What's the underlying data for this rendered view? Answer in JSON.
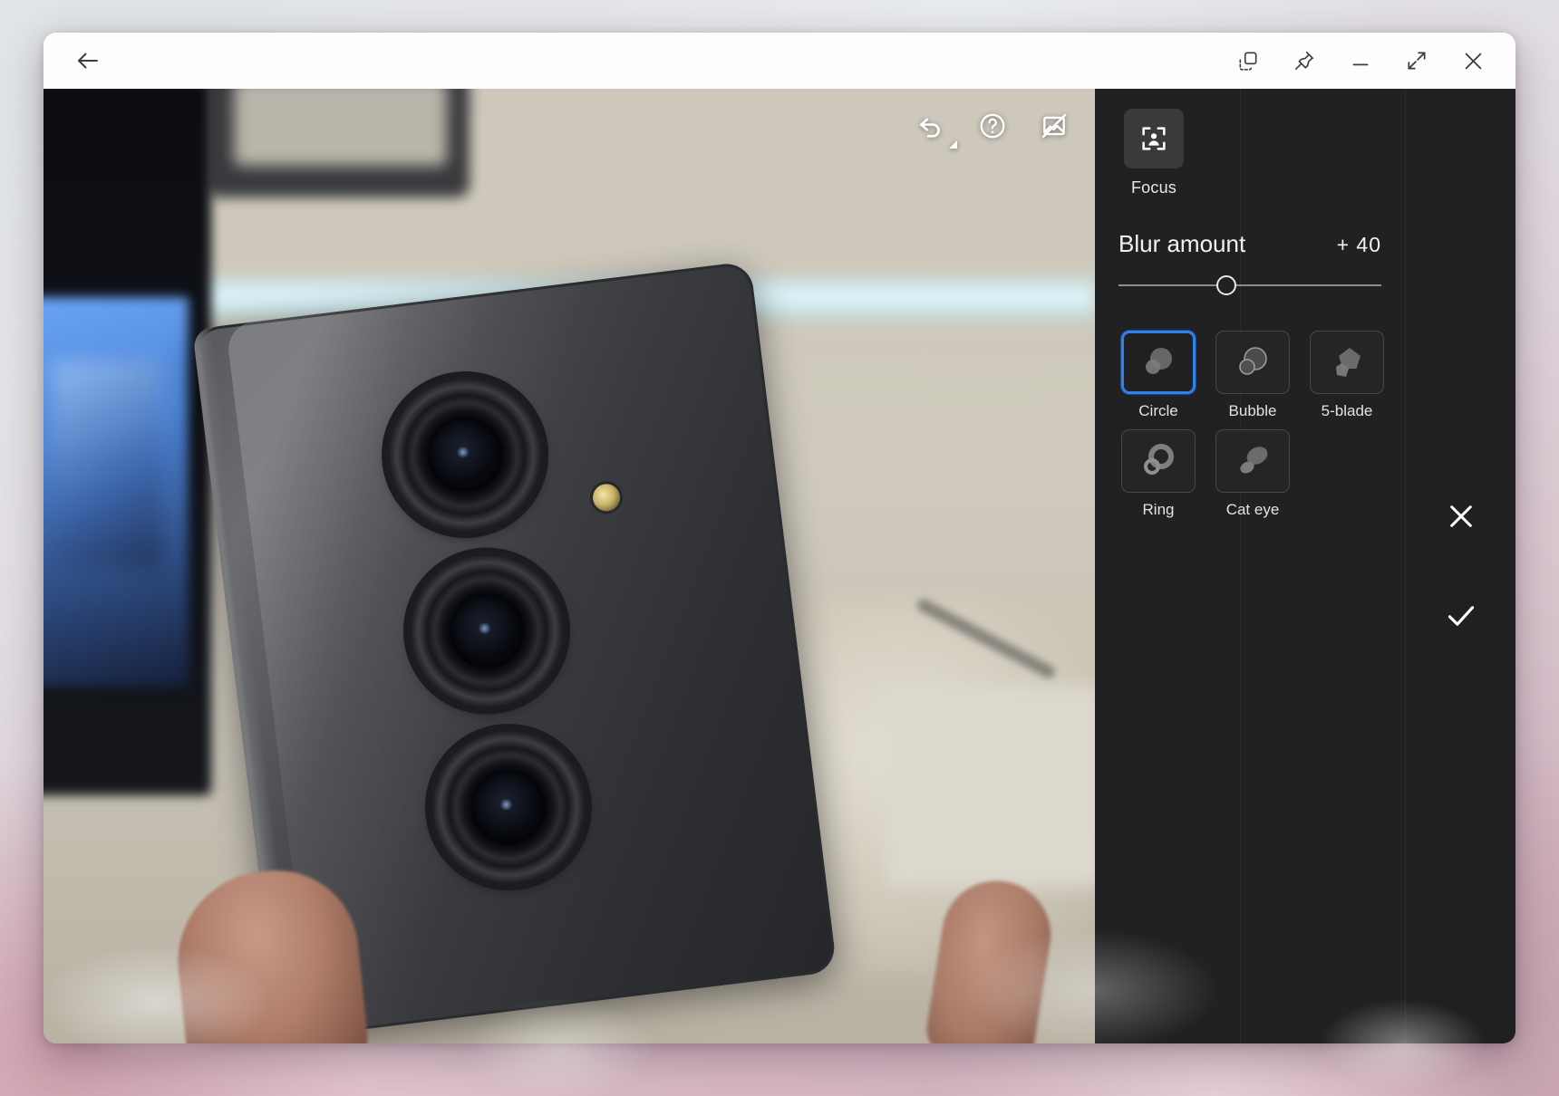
{
  "window": {
    "back_button": "back-arrow",
    "controls": [
      {
        "name": "duplicate-window-icon",
        "title": "Duplicate"
      },
      {
        "name": "pin-icon",
        "title": "Keep on top"
      },
      {
        "name": "minimize-icon",
        "title": "Minimize"
      },
      {
        "name": "maximize-icon",
        "title": "Maximize"
      },
      {
        "name": "close-icon",
        "title": "Close"
      }
    ]
  },
  "photo_toolbar": {
    "undo": {
      "label": "Undo",
      "icon": "undo-icon",
      "has_dropdown": true
    },
    "help": {
      "label": "Help",
      "icon": "help-circle-icon"
    },
    "compare": {
      "label": "Show original",
      "icon": "image-off-icon"
    }
  },
  "panel": {
    "tool": {
      "label": "Focus",
      "icon": "portrait-focus-icon",
      "selected": true
    },
    "slider": {
      "label": "Blur amount",
      "value_text": "+ 40",
      "value": 40,
      "min": 0,
      "max": 100,
      "percent": 41
    },
    "styles_heading": "",
    "styles": [
      {
        "label": "Circle",
        "icon": "bokeh-circle-icon",
        "selected": true
      },
      {
        "label": "Bubble",
        "icon": "bokeh-bubble-icon",
        "selected": false
      },
      {
        "label": "5-blade",
        "icon": "bokeh-5blade-icon",
        "selected": false
      },
      {
        "label": "Ring",
        "icon": "bokeh-ring-icon",
        "selected": false
      },
      {
        "label": "Cat eye",
        "icon": "bokeh-cateye-icon",
        "selected": false
      }
    ],
    "actions": {
      "cancel": {
        "label": "Cancel",
        "icon": "close-icon"
      },
      "apply": {
        "label": "Apply",
        "icon": "check-icon"
      }
    },
    "colors": {
      "panel_background": "#212123",
      "accent": "#2f80ed",
      "text": "#f2f2f2",
      "tool_tile": "#3a3a3c"
    }
  }
}
